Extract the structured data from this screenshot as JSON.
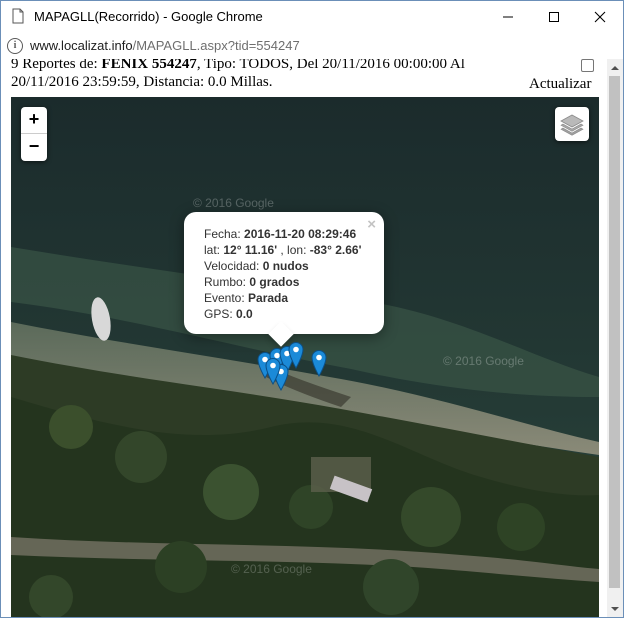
{
  "window": {
    "title": "MAPAGLL(Recorrido) - Google Chrome",
    "minimize_glyph": "—",
    "maximize_glyph": "☐",
    "close_glyph": "✕"
  },
  "address": {
    "info_glyph": "i",
    "domain": "www.localizat.info",
    "path": "/MAPAGLL.aspx?tid=554247"
  },
  "report": {
    "prefix": "9 Reportes de: ",
    "device": "FENIX 554247",
    "rest": ", Tipo: TODOS, Del 20/11/2016 00:00:00 Al 20/11/2016 23:59:59, Distancia: 0.0 Millas."
  },
  "actualizar_label": "Actualizar",
  "map": {
    "zoom_in": "+",
    "zoom_out": "−",
    "watermarks": [
      "© 2016 Google",
      "© 2016 Google",
      "© 2016 Google"
    ],
    "marker_color": "#1b8ad8"
  },
  "popup": {
    "close": "×",
    "fecha_label": "Fecha: ",
    "fecha_value": "2016-11-20 08:29:46",
    "lat_label": "lat: ",
    "lat_value": "12° 11.16'",
    "lon_label": " , lon: ",
    "lon_value": "-83° 2.66'",
    "velocidad_label": "Velocidad: ",
    "velocidad_value": "0 nudos",
    "rumbo_label": "Rumbo: ",
    "rumbo_value": "0 grados",
    "evento_label": "Evento: ",
    "evento_value": "Parada",
    "gps_label": "GPS: ",
    "gps_value": "0.0"
  }
}
